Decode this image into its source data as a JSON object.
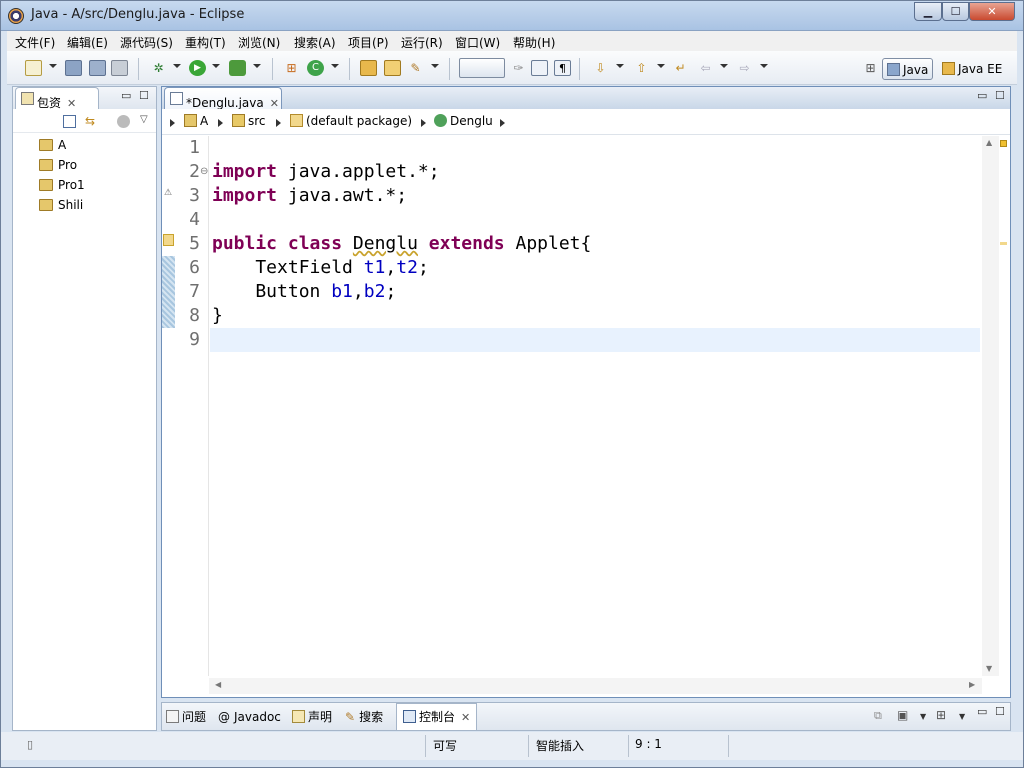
{
  "window": {
    "title": "Java  -  A/src/Denglu.java  -  Eclipse",
    "min_label": "▁",
    "max_label": "☐",
    "close_label": "✕"
  },
  "menu": [
    "文件(F)",
    "编辑(E)",
    "源代码(S)",
    "重构(T)",
    "浏览(N)",
    "搜索(A)",
    "项目(P)",
    "运行(R)",
    "窗口(W)",
    "帮助(H)"
  ],
  "perspectives": {
    "java": "Java",
    "javaee": "Java EE"
  },
  "package_explorer": {
    "tab_label": "包资",
    "projects": [
      "A",
      "Pro",
      "Pro1",
      "Shili"
    ]
  },
  "editor": {
    "tab_label": "*Denglu.java",
    "breadcrumb": [
      "A",
      "src",
      "(default package)",
      "Denglu"
    ],
    "line_numbers": [
      "1",
      "2",
      "3",
      "4",
      "5",
      "6",
      "7",
      "8",
      "9"
    ],
    "fold_marker": "⊖",
    "code": {
      "l2_kw": "import",
      "l2_rest": " java.applet.*;",
      "l3_kw": "import",
      "l3_rest": " java.awt.*;",
      "l5_kw1": "public",
      "l5_kw2": "class",
      "l5_name": "Denglu",
      "l5_kw3": "extends",
      "l5_rest": " Applet{",
      "l6_type": "    TextField ",
      "l6_f1": "t1",
      "l6_comma": ",",
      "l6_f2": "t2",
      "l6_end": ";",
      "l7_type": "    Button ",
      "l7_f1": "b1",
      "l7_comma": ",",
      "l7_f2": "b2",
      "l7_end": ";",
      "l8": "}"
    }
  },
  "bottom_tabs": [
    "问题",
    "Javadoc",
    "声明",
    "搜索",
    "控制台"
  ],
  "status": {
    "writable": "可写",
    "insert_mode": "智能插入",
    "position": "9 : 1"
  },
  "colors": {
    "keyword": "#7f0055",
    "field": "#0000c0",
    "current_line": "#e8f2fe"
  }
}
